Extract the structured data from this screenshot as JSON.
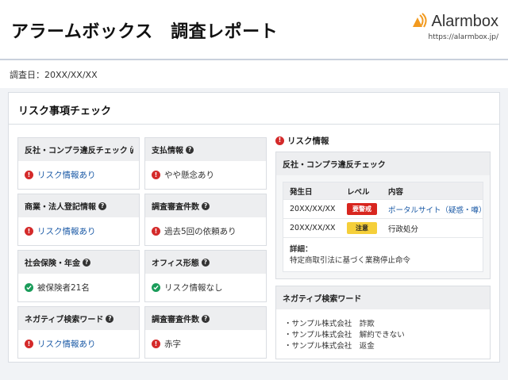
{
  "header": {
    "title": "アラームボックス　調査レポート",
    "brand_name": "Alarmbox",
    "brand_url": "https://alarmbox.jp/",
    "brand_color": "#f29a1f"
  },
  "report_date": "調査日：20XX/XX/XX",
  "risk_check": {
    "title": "リスク事項チェック",
    "items": [
      {
        "label": "反社・コンプラ違反チェック",
        "status": "リスク情報あり",
        "type": "alert",
        "link": true
      },
      {
        "label": "支払情報",
        "status": "やや懸念あり",
        "type": "alert",
        "link": false
      },
      {
        "label": "商業・法人登記情報",
        "status": "リスク情報あり",
        "type": "alert",
        "link": true
      },
      {
        "label": "調査審査件数",
        "status": "過去5回の依頼あり",
        "type": "alert",
        "link": false
      },
      {
        "label": "社会保険・年金",
        "status": "被保険者21名",
        "type": "ok",
        "link": false
      },
      {
        "label": "オフィス形態",
        "status": "リスク情報なし",
        "type": "ok",
        "link": false
      },
      {
        "label": "ネガティブ検索ワード",
        "status": "リスク情報あり",
        "type": "alert",
        "link": true
      },
      {
        "label": "調査審査件数",
        "status": "赤字",
        "type": "alert",
        "link": false
      }
    ]
  },
  "risk_info": {
    "title": "リスク情報",
    "compliance": {
      "title": "反社・コンプラ違反チェック",
      "columns": [
        "発生日",
        "レベル",
        "内容"
      ],
      "rows": [
        {
          "date": "20XX/XX/XX",
          "level": "要警戒",
          "level_color": "#d8261f",
          "content": "ポータルサイト（疑惑・噂）",
          "link": true
        },
        {
          "date": "20XX/XX/XX",
          "level": "注意",
          "level_color": "#f5cf3a",
          "content": "行政処分",
          "link": false
        }
      ],
      "detail_label": "詳細：",
      "detail_text": "特定商取引法に基づく業務停止命令"
    },
    "negative": {
      "title": "ネガティブ検索ワード",
      "words": [
        "・サンプル株式会社　詐欺",
        "・サンプル株式会社　解約できない",
        "・サンプル株式会社　返金"
      ]
    }
  },
  "colors": {
    "alert": "#d42a2a",
    "ok": "#1a9c5a",
    "link": "#1b5aa6"
  }
}
